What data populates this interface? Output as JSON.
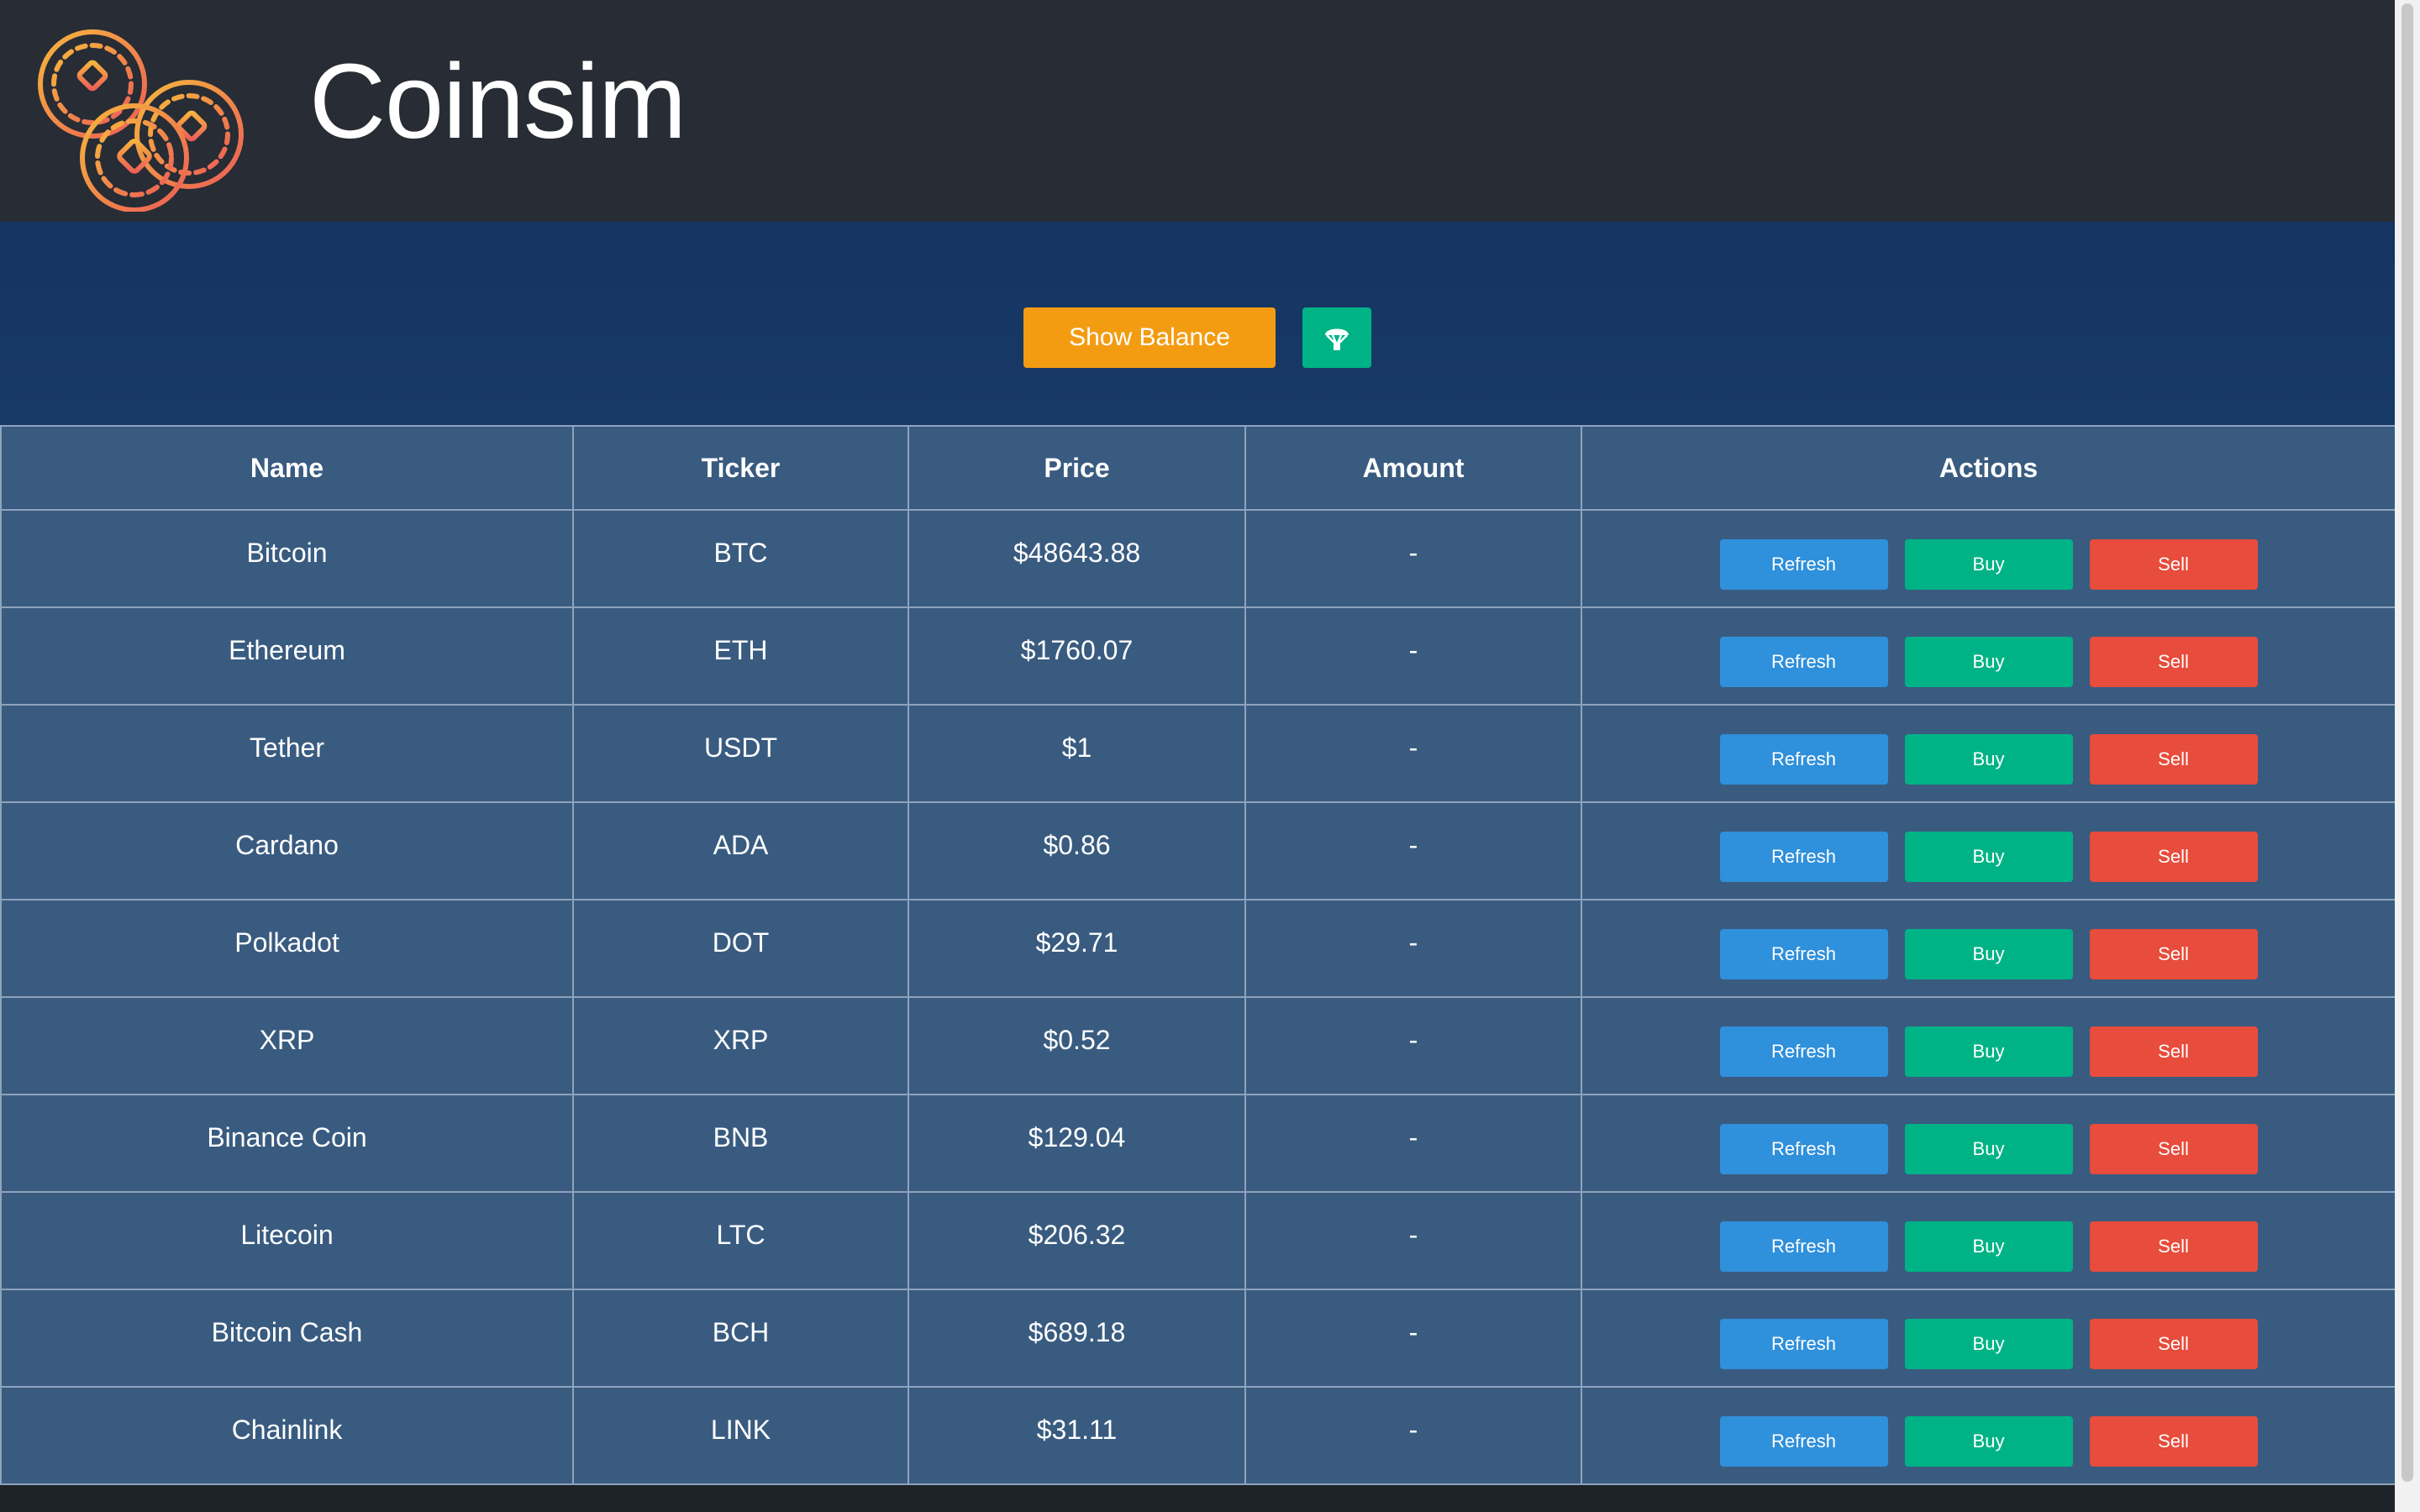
{
  "header": {
    "app_title": "Coinsim",
    "logo_icon": "coins-logo-icon"
  },
  "toolbar": {
    "show_balance_label": "Show Balance",
    "airdrop_icon": "parachute-icon"
  },
  "table": {
    "headers": {
      "name": "Name",
      "ticker": "Ticker",
      "price": "Price",
      "amount": "Amount",
      "actions": "Actions"
    },
    "action_labels": {
      "refresh": "Refresh",
      "buy": "Buy",
      "sell": "Sell"
    },
    "rows": [
      {
        "name": "Bitcoin",
        "ticker": "BTC",
        "price": "$48643.88",
        "amount": "-"
      },
      {
        "name": "Ethereum",
        "ticker": "ETH",
        "price": "$1760.07",
        "amount": "-"
      },
      {
        "name": "Tether",
        "ticker": "USDT",
        "price": "$1",
        "amount": "-"
      },
      {
        "name": "Cardano",
        "ticker": "ADA",
        "price": "$0.86",
        "amount": "-"
      },
      {
        "name": "Polkadot",
        "ticker": "DOT",
        "price": "$29.71",
        "amount": "-"
      },
      {
        "name": "XRP",
        "ticker": "XRP",
        "price": "$0.52",
        "amount": "-"
      },
      {
        "name": "Binance Coin",
        "ticker": "BNB",
        "price": "$129.04",
        "amount": "-"
      },
      {
        "name": "Litecoin",
        "ticker": "LTC",
        "price": "$206.32",
        "amount": "-"
      },
      {
        "name": "Bitcoin Cash",
        "ticker": "BCH",
        "price": "$689.18",
        "amount": "-"
      },
      {
        "name": "Chainlink",
        "ticker": "LINK",
        "price": "$31.11",
        "amount": "-"
      }
    ]
  },
  "colors": {
    "header_bg": "#282c34",
    "toolbar_bg": "#143462",
    "table_bg": "#395b80",
    "show_balance": "#f39c12",
    "refresh": "#2f90db",
    "buy": "#00b386",
    "sell": "#e74c3c"
  }
}
